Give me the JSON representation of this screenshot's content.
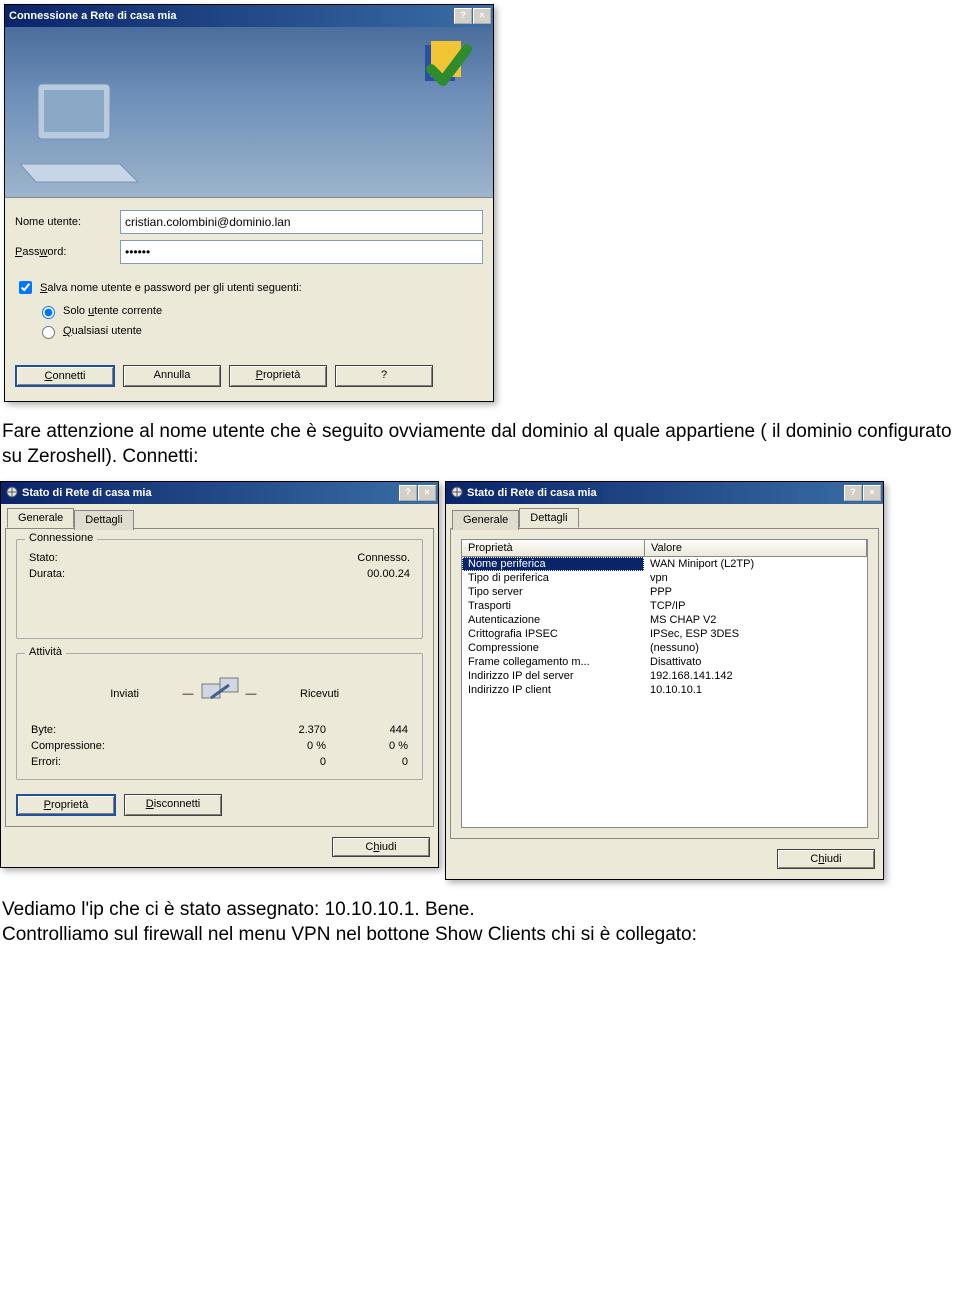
{
  "connection_dialog": {
    "title": "Connessione a Rete di casa mia",
    "username_label": "Nome utente:",
    "username_value": "cristian.colombini@dominio.lan",
    "password_label": "Password:",
    "password_value": "••••••",
    "save_checkbox_label": "Salva nome utente e password per gli utenti seguenti:",
    "save_checkbox_checked": true,
    "radio_current_user": "Solo utente corrente",
    "radio_any_user": "Qualsiasi utente",
    "radio_selected": "current",
    "buttons": {
      "connect": "Connetti",
      "cancel": "Annulla",
      "properties": "Proprietà",
      "help": "?"
    }
  },
  "doc_text_1": "Fare attenzione al nome utente che è seguito ovviamente dal dominio al quale appartiene ( il dominio configurato su Zeroshell). Connetti:",
  "status_dialog_general": {
    "title": "Stato di Rete di casa mia",
    "tabs": {
      "general": "Generale",
      "details": "Dettagli"
    },
    "group_conn": "Connessione",
    "conn_state_label": "Stato:",
    "conn_state_value": "Connesso.",
    "conn_duration_label": "Durata:",
    "conn_duration_value": "00.00.24",
    "group_activity": "Attività",
    "sent_label": "Inviati",
    "recv_label": "Ricevuti",
    "rows": {
      "bytes_label": "Byte:",
      "bytes_sent": "2.370",
      "bytes_recv": "444",
      "compression_label": "Compressione:",
      "compression_sent": "0 %",
      "compression_recv": "0 %",
      "errors_label": "Errori:",
      "errors_sent": "0",
      "errors_recv": "0"
    },
    "buttons": {
      "properties": "Proprietà",
      "disconnect": "Disconnetti",
      "close": "Chiudi"
    }
  },
  "status_dialog_details": {
    "title": "Stato di Rete di casa mia",
    "tabs": {
      "general": "Generale",
      "details": "Dettagli"
    },
    "col_property": "Proprietà",
    "col_value": "Valore",
    "rows": [
      {
        "k": "Nome periferica",
        "v": "WAN Miniport (L2TP)",
        "selected": true
      },
      {
        "k": "Tipo di periferica",
        "v": "vpn"
      },
      {
        "k": "Tipo server",
        "v": "PPP"
      },
      {
        "k": "Trasporti",
        "v": "TCP/IP"
      },
      {
        "k": "Autenticazione",
        "v": "MS CHAP V2"
      },
      {
        "k": "Crittografia IPSEC",
        "v": "IPSec, ESP 3DES"
      },
      {
        "k": "Compressione",
        "v": "(nessuno)"
      },
      {
        "k": "Frame collegamento m...",
        "v": "Disattivato"
      },
      {
        "k": "Indirizzo IP del server",
        "v": "192.168.141.142"
      },
      {
        "k": "Indirizzo IP client",
        "v": "10.10.10.1"
      }
    ],
    "buttons": {
      "close": "Chiudi"
    }
  },
  "doc_text_2a": "Vediamo l'ip che ci è stato assegnato: 10.10.10.1. Bene.",
  "doc_text_2b": "Controlliamo sul firewall nel menu VPN nel bottone Show Clients chi si è collegato:"
}
